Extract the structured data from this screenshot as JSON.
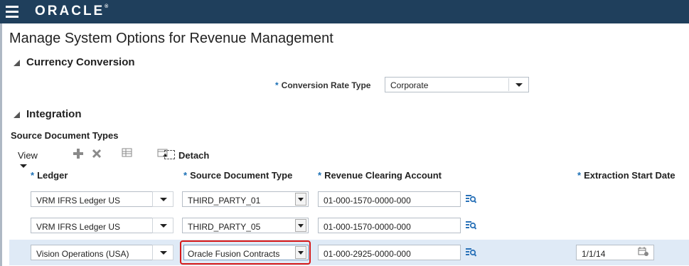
{
  "header": {
    "logo": "ORACLE",
    "logo_mark": "®"
  },
  "page": {
    "title": "Manage System Options for Revenue Management"
  },
  "currency": {
    "section_title": "Currency Conversion",
    "rate_type_label": "Conversion Rate Type",
    "rate_type_value": "Corporate",
    "required_mark": "*"
  },
  "integration": {
    "section_title": "Integration"
  },
  "sdt": {
    "title": "Source Document Types",
    "toolbar": {
      "view": "View",
      "detach": "Detach"
    },
    "columns": [
      "Ledger",
      "Source Document Type",
      "Revenue Clearing Account",
      "Extraction Start Date"
    ],
    "rows": [
      {
        "ledger": "VRM IFRS Ledger US",
        "type": "THIRD_PARTY_01",
        "account": "01-000-1570-0000-000",
        "date": ""
      },
      {
        "ledger": "VRM IFRS Ledger US",
        "type": "THIRD_PARTY_05",
        "account": "01-000-1570-0000-000",
        "date": ""
      },
      {
        "ledger": "Vision Operations (USA)",
        "type": "Oracle Fusion Contracts",
        "account": "01-000-2925-0000-000",
        "date": "1/1/14"
      }
    ]
  },
  "colors": {
    "topbar": "#1f3f5c",
    "selected_row": "#dfeaf6",
    "highlight": "#d61818",
    "required": "#1a6fb5"
  }
}
